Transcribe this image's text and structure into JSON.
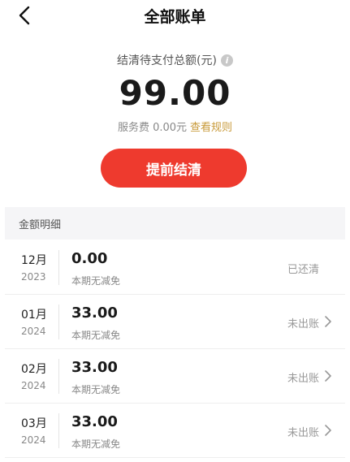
{
  "header": {
    "title": "全部账单"
  },
  "summary": {
    "label": "结清待支付总额(元)",
    "info_icon_glyph": "i",
    "amount": "99.00",
    "fee_text": "服务费 0.00元",
    "rule_link": "查看规则"
  },
  "actions": {
    "prepay_label": "提前结清"
  },
  "section": {
    "title": "金额明细"
  },
  "bills": [
    {
      "month": "12月",
      "year": "2023",
      "amount": "0.00",
      "note": "本期无减免",
      "status": "已还清",
      "has_chevron": false
    },
    {
      "month": "01月",
      "year": "2024",
      "amount": "33.00",
      "note": "本期无减免",
      "status": "未出账",
      "has_chevron": true
    },
    {
      "month": "02月",
      "year": "2024",
      "amount": "33.00",
      "note": "本期无减免",
      "status": "未出账",
      "has_chevron": true
    },
    {
      "month": "03月",
      "year": "2024",
      "amount": "33.00",
      "note": "本期无减免",
      "status": "未出账",
      "has_chevron": true
    }
  ],
  "colors": {
    "primary_button": "#ee3a2e",
    "link": "#c89a3a",
    "section_bg": "#f5f5f7"
  }
}
